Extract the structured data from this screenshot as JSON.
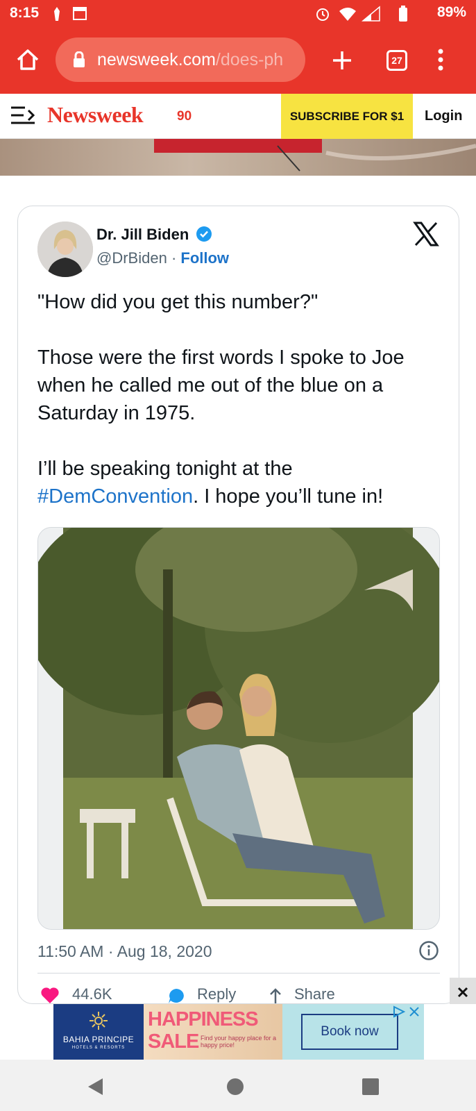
{
  "status_bar": {
    "time": "8:15",
    "battery": "89%"
  },
  "browser": {
    "url_domain": "newsweek.com",
    "url_path": "/does-ph",
    "tab_count": "27"
  },
  "site_header": {
    "logo": "Newsweek",
    "anniversary": "90",
    "subscribe_label": "SUBSCRIBE FOR $1",
    "login_label": "Login"
  },
  "tweet": {
    "author_name": "Dr. Jill Biden",
    "handle": "@DrBiden",
    "separator": " · ",
    "follow_label": "Follow",
    "paragraph1": "\"How did you get this number?\"",
    "paragraph2": "Those were the first words I spoke to Joe when he called me out of the blue on a Saturday in 1975.",
    "paragraph3_before": "I’ll be speaking tonight at the ",
    "hashtag": "#DemConvention",
    "paragraph3_after": ". I hope you’ll tune in!",
    "timestamp": "11:50 AM · Aug 18, 2020",
    "likes": "44.6K",
    "reply_label": "Reply",
    "share_label": "Share"
  },
  "ad": {
    "brand": "BAHIA PRINCIPE",
    "brand_sub": "HOTELS & RESORTS",
    "headline1": "HAPPINESS",
    "headline2": "SALE",
    "tagline": "Find your happy place for a happy price!",
    "cta": "Book now"
  },
  "colors": {
    "chrome": "#e8352a",
    "link": "#1d73c9",
    "subscribe": "#f7e341"
  }
}
